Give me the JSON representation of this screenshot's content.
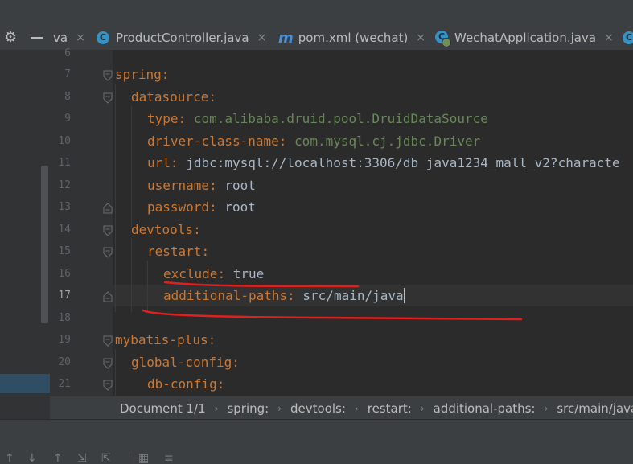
{
  "tabs": [
    {
      "label": "va",
      "icon": "partial-tab",
      "closable": true
    },
    {
      "label": "ProductController.java",
      "icon": "java-class-icon",
      "closable": true
    },
    {
      "label": "pom.xml (wechat)",
      "icon": "maven-icon",
      "closable": true
    },
    {
      "label": "WechatApplication.java",
      "icon": "spring-boot-app-icon",
      "closable": true
    }
  ],
  "tab_close_glyph": "×",
  "gutter": {
    "line_numbers": [
      "6",
      "7",
      "8",
      "9",
      "10",
      "11",
      "12",
      "13",
      "14",
      "15",
      "16",
      "17",
      "18",
      "19",
      "20",
      "21"
    ],
    "current_line": "17"
  },
  "code": {
    "lines": [
      {
        "line": "6",
        "key": "",
        "value": ""
      },
      {
        "line": "7",
        "key": "spring",
        "value": ""
      },
      {
        "line": "8",
        "key": "datasource",
        "value": ""
      },
      {
        "line": "9",
        "key": "type",
        "value": "com.alibaba.druid.pool.DruidDataSource"
      },
      {
        "line": "10",
        "key": "driver-class-name",
        "value": "com.mysql.cj.jdbc.Driver"
      },
      {
        "line": "11",
        "key": "url",
        "value": "jdbc:mysql://localhost:3306/db_java1234_mall_v2?characte"
      },
      {
        "line": "12",
        "key": "username",
        "value": "root"
      },
      {
        "line": "13",
        "key": "password",
        "value": "root"
      },
      {
        "line": "14",
        "key": "devtools",
        "value": ""
      },
      {
        "line": "15",
        "key": "restart",
        "value": ""
      },
      {
        "line": "16",
        "key": "exclude",
        "value": "true"
      },
      {
        "line": "17",
        "key": "additional-paths",
        "value": "src/main/java"
      },
      {
        "line": "18",
        "key": "",
        "value": ""
      },
      {
        "line": "19",
        "key": "mybatis-plus",
        "value": ""
      },
      {
        "line": "20",
        "key": "global-config",
        "value": ""
      },
      {
        "line": "21",
        "key": "db-config",
        "value": ""
      }
    ],
    "colon": ":"
  },
  "breadcrumb": {
    "document": "Document 1/1",
    "crumbs": [
      "spring:",
      "devtools:",
      "restart:",
      "additional-paths:",
      "src/main/java"
    ],
    "separator": "›"
  },
  "colors": {
    "editor_bg": "#2b2b2b",
    "yaml_key": "#cc7832",
    "yaml_value": "#6a8759",
    "plain_text": "#a9b7c6",
    "annotation_red": "#e0201e"
  },
  "icons": {
    "settings": "gear-icon",
    "hide": "minus-icon"
  }
}
